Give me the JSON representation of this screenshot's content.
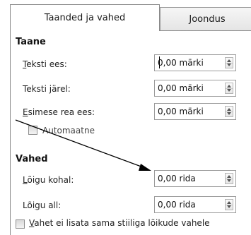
{
  "tabs": [
    {
      "label": "Taanded ja vahed",
      "active": true
    },
    {
      "label": "Joondus",
      "active": false
    }
  ],
  "taane": {
    "title": "Taane",
    "rows": [
      {
        "label_underline": "T",
        "label_rest": "eksti ees:",
        "value": "0,00 märki"
      },
      {
        "label": "Teksti järel:",
        "value": "0,00 märki"
      },
      {
        "label_underline": "E",
        "label_rest": "simese rea ees:",
        "value": "0,00 märki"
      }
    ],
    "automatic": {
      "label": "Automaatne",
      "checked": false
    }
  },
  "vahed": {
    "title": "Vahed",
    "rows": [
      {
        "label_pre": "",
        "label_underline": "L",
        "label_rest": "õigu kohal:",
        "value": "0,00 rida"
      },
      {
        "label_pre": "Lõi",
        "label_underline": "g",
        "label_rest": "u all:",
        "value": "0,00 rida"
      }
    ],
    "no_space_same_style": {
      "label_underline": "V",
      "label_rest": "ahet ei lisata sama stiiliga lõikude vahele",
      "checked": false
    }
  }
}
